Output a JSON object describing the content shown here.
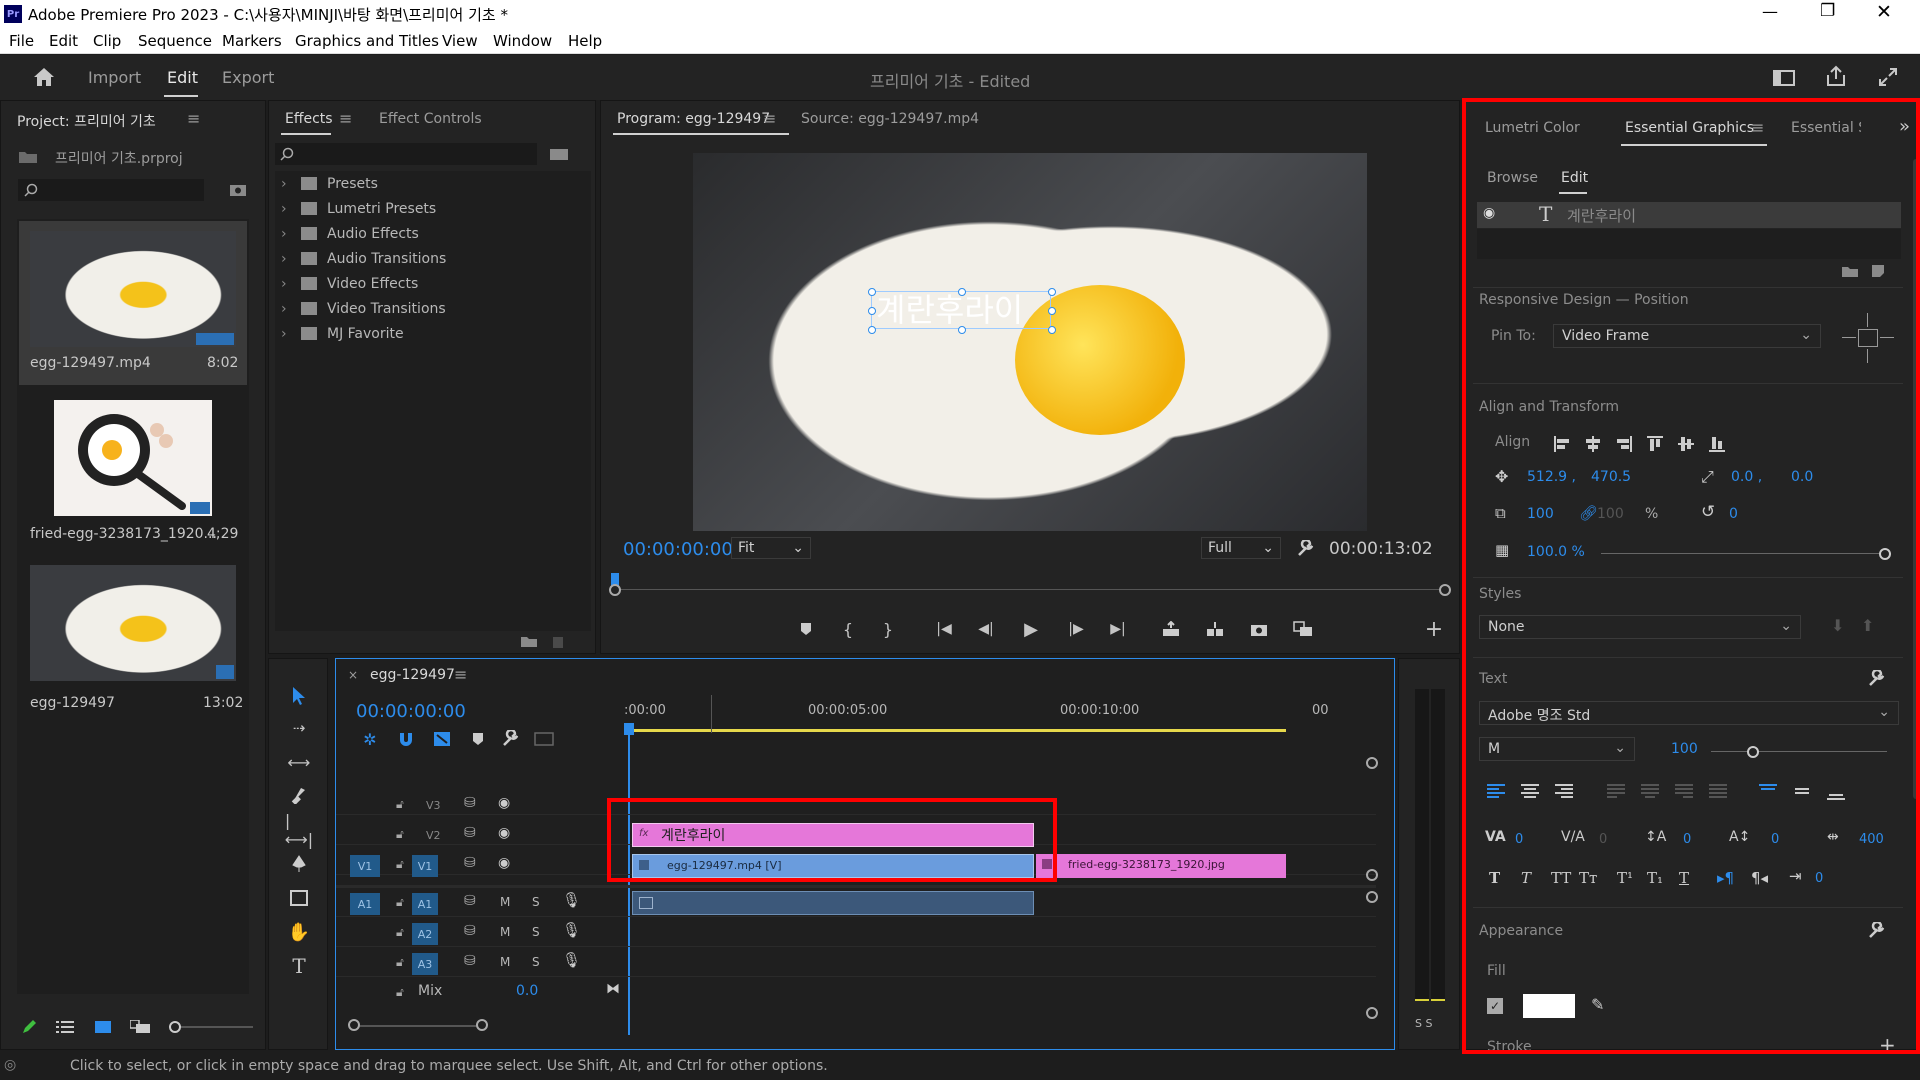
{
  "window": {
    "title": "Adobe Premiere Pro 2023 - C:\\사용자\\MINJI\\바탕 화면\\프리미어 기초 *"
  },
  "menu": [
    "File",
    "Edit",
    "Clip",
    "Sequence",
    "Markers",
    "Graphics and Titles",
    "View",
    "Window",
    "Help"
  ],
  "workspace": {
    "tabs": [
      "Import",
      "Edit",
      "Export"
    ],
    "doc_title": "프리미어 기초 - Edited"
  },
  "project": {
    "title": "Project: 프리미어 기초",
    "file": "프리미어 기초.prproj",
    "items": [
      {
        "name": "egg-129497.mp4",
        "duration": "8:02"
      },
      {
        "name": "fried-egg-3238173_1920...",
        "duration": "4;29"
      },
      {
        "name": "egg-129497",
        "duration": "13:02"
      }
    ]
  },
  "effects": {
    "tabs": [
      "Effects",
      "Effect Controls"
    ],
    "folders": [
      "Presets",
      "Lumetri Presets",
      "Audio Effects",
      "Audio Transitions",
      "Video Effects",
      "Video Transitions",
      "MJ Favorite"
    ]
  },
  "program": {
    "tab": "Program: egg-129497",
    "source_tab": "Source: egg-129497.mp4",
    "timecode": "00:00:00:00",
    "fit": "Fit",
    "quality": "Full",
    "duration": "00:00:13:02",
    "overlay_text": "계란후라이"
  },
  "timeline": {
    "tab": "egg-129497",
    "timecode": "00:00:00:00",
    "ruler": [
      ":00:00",
      "00:00:05:00",
      "00:00:10:00",
      "00"
    ],
    "tracks_video": [
      "V3",
      "V2",
      "V1"
    ],
    "tracks_audio": [
      "A1",
      "A2",
      "A3"
    ],
    "src_v": "V1",
    "src_a": "A1",
    "mix_label": "Mix",
    "mix_value": "0.0",
    "clip_title": "계란후라이",
    "clip_v1": "egg-129497.mp4 [V]",
    "clip_v1b": "fried-egg-3238173_1920.jpg",
    "m": "M",
    "s": "S",
    "meter": "S S"
  },
  "eg": {
    "tabs": [
      "Lumetri Color",
      "Essential Graphics",
      "Essential Sou"
    ],
    "subtabs": [
      "Browse",
      "Edit"
    ],
    "layer": "계란후라이",
    "responsive_title": "Responsive Design — Position",
    "pin_label": "Pin To:",
    "pin_value": "Video Frame",
    "align_title": "Align and Transform",
    "align_label": "Align",
    "pos_x": "512.9 ,",
    "pos_y": "470.5",
    "anchor_x": "0.0 ,",
    "anchor_y": "0.0",
    "scale": "100",
    "scale2": "100",
    "pct": "%",
    "rotation": "0",
    "opacity": "100.0 %",
    "styles_title": "Styles",
    "styles_value": "None",
    "text_title": "Text",
    "font": "Adobe 명조 Std",
    "weight": "M",
    "size": "100",
    "kern": "0",
    "track": "0",
    "lead": "0",
    "baseline": "0",
    "tsume": "400",
    "indent": "0",
    "appearance_title": "Appearance",
    "fill_label": "Fill",
    "stroke_label": "Stroke"
  },
  "status": "Click to select, or click in empty space and drag to marquee select. Use Shift, Alt, and Ctrl for other options.",
  "colors": {
    "accent": "#2d8ceb",
    "highlight": "#ff0000",
    "title_clip": "#e577d9",
    "video_clip": "#6a9cdd"
  }
}
